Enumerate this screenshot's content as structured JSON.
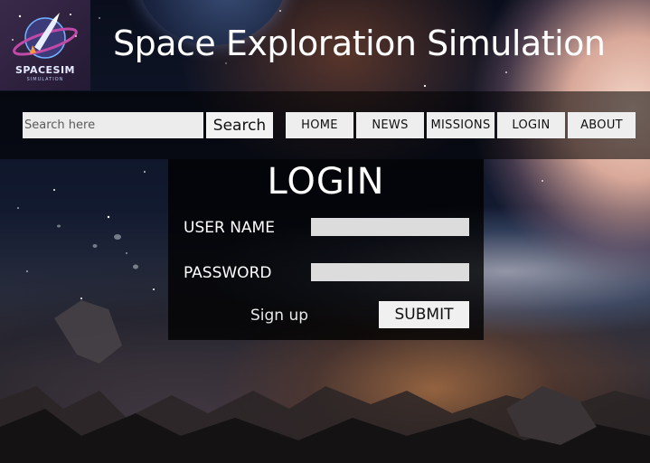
{
  "header": {
    "logo": {
      "brand": "SPACESIM",
      "sub": "SIMULATION"
    },
    "title": "Space Exploration Simulation"
  },
  "search": {
    "placeholder": "Search here",
    "button_label": "Search"
  },
  "nav": {
    "items": [
      {
        "label": "HOME"
      },
      {
        "label": "NEWS"
      },
      {
        "label": "MISSIONS"
      },
      {
        "label": "LOGIN"
      },
      {
        "label": "ABOUT"
      }
    ]
  },
  "login": {
    "title": "LOGIN",
    "username_label": "USER NAME",
    "password_label": "PASSWORD",
    "signup_label": "Sign up",
    "submit_label": "SUBMIT"
  }
}
